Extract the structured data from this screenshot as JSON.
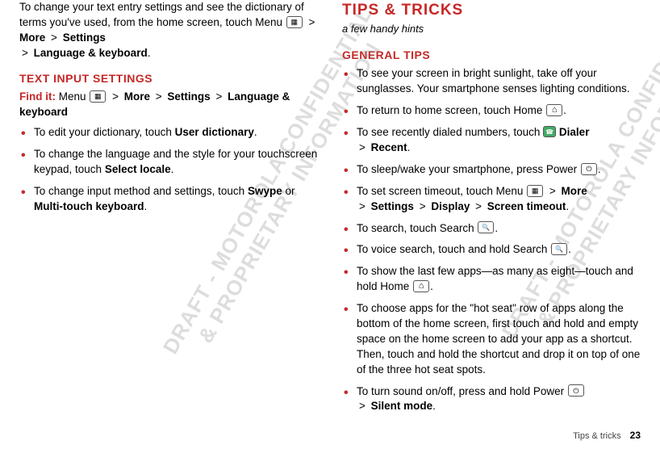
{
  "left": {
    "intro_pre": "To change your text entry settings and see the dictionary of terms you've used, from the home screen, touch Menu",
    "intro_more": "More",
    "intro_settings": "Settings",
    "intro_lang": "Language & keyboard",
    "heading1": "TEXT INPUT SETTINGS",
    "findit": "Find it:",
    "findit_menu": "Menu",
    "findit_more": "More",
    "findit_settings": "Settings",
    "findit_lang": "Language & keyboard",
    "bullets": [
      {
        "pre": "To edit your dictionary, touch ",
        "b1": "User dictionary",
        "post": "."
      },
      {
        "pre": "To change the language and the style for your touchscreen keypad, touch ",
        "b1": "Select locale",
        "post": "."
      },
      {
        "pre": "To change input method and settings, touch ",
        "b1": "Swype",
        "mid": " or ",
        "b2": "Multi-touch keyboard",
        "post": "."
      }
    ]
  },
  "right": {
    "title": "TIPS & TRICKS",
    "subtitle": "a few handy hints",
    "heading": "GENERAL TIPS",
    "tips": {
      "t0": "To see your screen in bright sunlight, take off your sunglasses. Your smartphone senses lighting conditions.",
      "t1_pre": "To return to home screen, touch Home",
      "t2_pre": "To see recently dialed numbers, touch",
      "t2_dialer": "Dialer",
      "t2_recent": "Recent",
      "t3_pre": "To sleep/wake your smartphone, press Power",
      "t4_pre": "To set screen timeout, touch Menu",
      "t4_more": "More",
      "t4_settings": "Settings",
      "t4_display": "Display",
      "t4_timeout": "Screen timeout",
      "t5_pre": "To search, touch Search",
      "t6_pre": "To voice search, touch and hold Search",
      "t7_pre": "To show the last few apps—as many as eight—touch and hold Home",
      "t8": "To choose apps for the \"hot seat\" row of apps along the bottom of the home screen, first touch and hold and empty space on the home screen to add your app as a shortcut. Then, touch and hold the shortcut and drop it on top of one of the three hot seat spots.",
      "t9_pre": "To turn sound on/off, press and hold Power",
      "t9_silent": "Silent mode"
    }
  },
  "footer": {
    "label": "Tips & tricks",
    "page": "23"
  },
  "watermark1": "DRAFT - MOTOROLA CONFIDENTIAL\n& PROPRIETARY INFORMATION",
  "watermark2": "DRAFT - MOTOROLA CONFIDENTIAL\n& PROPRIETARY INFORMATION"
}
